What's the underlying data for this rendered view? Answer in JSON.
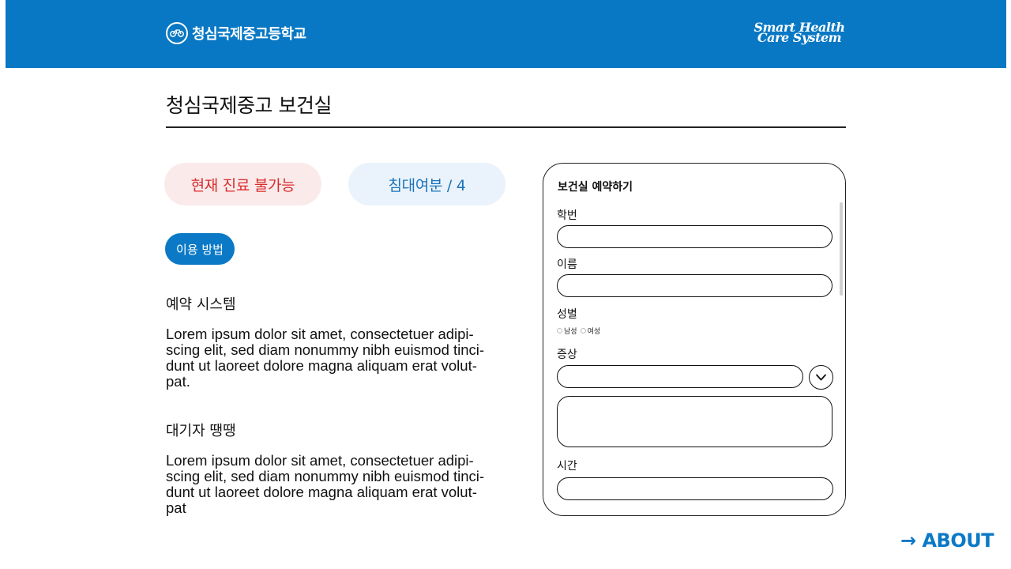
{
  "header": {
    "school_name": "청심국제중고등학교",
    "system_logo_line1": "Smart Health",
    "system_logo_line2": "Care System",
    "background_color": "#0878c4"
  },
  "main": {
    "page_title": "청심국제중고 보건실",
    "status_pill": "현재 진료 불가능",
    "status_color": "#d72d2d",
    "beds_pill": "침대여분 / 4",
    "beds_color": "#1b73b9",
    "how_to_use_button": "이용 방법",
    "sections": [
      {
        "heading": "예약 시스템",
        "body": "Lorem ipsum dolor sit amet, consectetuer adipi-\nscing elit, sed diam nonummy nibh euismod tinci-\ndunt ut laoreet dolore magna aliquam erat volut-\npat."
      },
      {
        "heading": "대기자 땡땡",
        "body": "Lorem ipsum dolor sit amet, consectetuer adipi-\nscing elit, sed diam nonummy nibh euismod tinci-\ndunt ut laoreet dolore magna aliquam erat volut-\npat"
      }
    ]
  },
  "form": {
    "title": "보건실 예약하기",
    "student_id_label": "학번",
    "student_id_value": "",
    "name_label": "이름",
    "name_value": "",
    "gender_label": "성별",
    "gender_options": [
      "남성",
      "여성"
    ],
    "symptom_label": "증상",
    "symptom_value": "",
    "symptom_detail_value": "",
    "time_label": "시간",
    "time_value": "",
    "dropdown_icon": "chevron-down-icon"
  },
  "footer": {
    "about_link": "→ ABOUT",
    "accent_color": "#0b79c6"
  }
}
